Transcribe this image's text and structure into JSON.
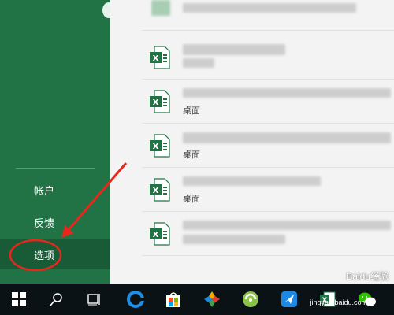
{
  "sidebar": {
    "items": [
      {
        "label": "帐户"
      },
      {
        "label": "反馈"
      },
      {
        "label": "选项"
      }
    ]
  },
  "recent_files": {
    "location_label": "桌面",
    "count": 6
  },
  "taskbar": {
    "icons": [
      "windows-start-icon",
      "search-icon",
      "task-view-icon",
      "edge-icon",
      "store-icon",
      "photos-icon",
      "green-app-icon",
      "blue-app-icon",
      "excel-icon",
      "wechat-icon"
    ]
  },
  "watermark": {
    "text": "Baidu经验",
    "url": "jingyan.baidu.com"
  },
  "colors": {
    "sidebar": "#217346",
    "selected": "#195a37",
    "annotation": "#e8271c"
  }
}
